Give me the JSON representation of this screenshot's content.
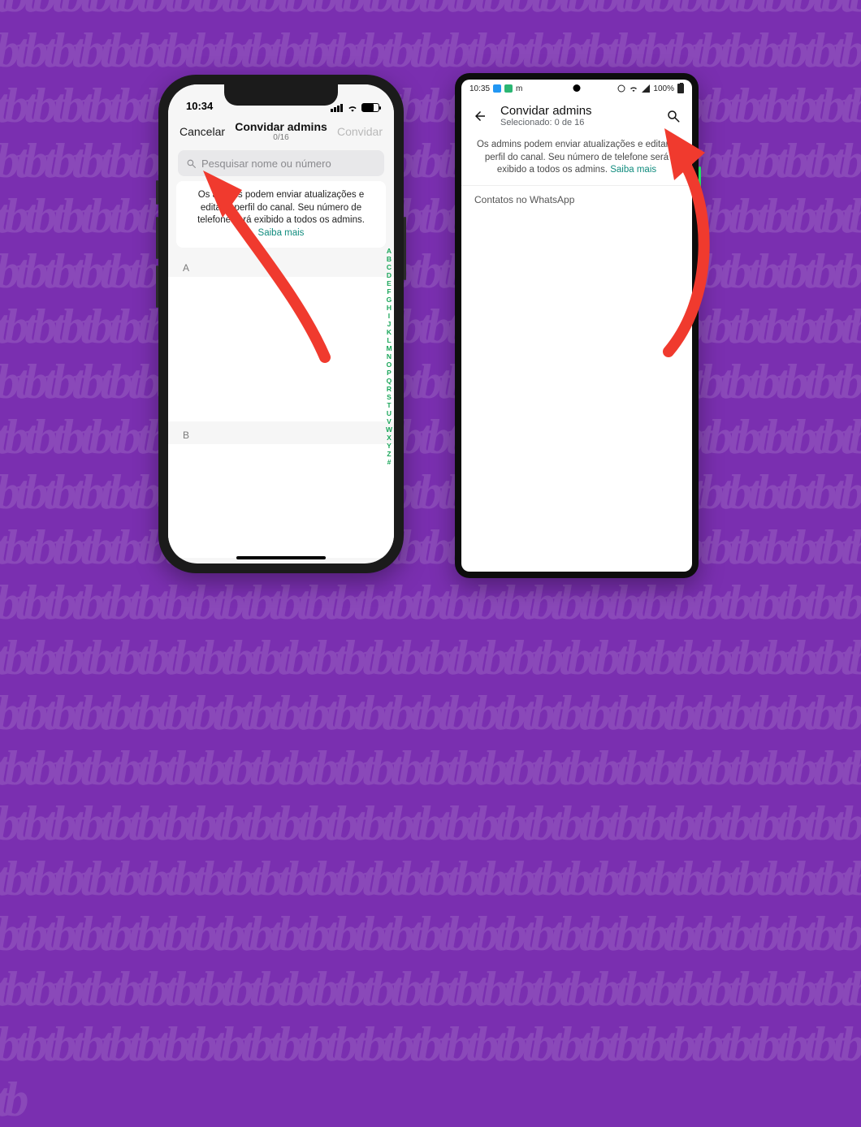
{
  "bg_text": "tbtbtbtbtbtbtbtbtbtbtbtbtbtbtbtbtbtbtbtbtbtbtbtbtbtbtbtbtbtbtbtbtbtbtbtbtbtbtbtbtbtbtbtbtbtbtbtbtbtbtbtbtbtbtbtbtbtbtbtbtbtbtbtbtbtbtbtbtbtbtbtbtbtbtbtbtbtbtbtbtbtbtbtbtbtbtbtbtbtbtbtbtbtbtbtbtbtbtbtbtbtbtbtbtbtbtbtbtbtbtbtbtbtbtbtbtbtbtbtbtbtbtbtbtbtbtbtbtbtbtbtbtbtbtbtbtbtbtbtbtbtbtbtbtbtbtbtbtbtbtbtbtbtbtbtbtbtbtbtbtbtbtbtbtbtbtbtbtbtbtbtbtbtbtbtbtbtbtbtbtbtbtbtbtbtbtbtbtbtbtbtbtbtbtbtbtbtbtbtbtbtbtbtbtbtbtbtbtbtbtbtbtbtbtbtbtbtbtbtbtbtbtbtbtbtbtbtbtbtbtbtbtbtbtbtbtbtbtbtbtbtbtbtbtbtbtbtbtbtbtbtbtbtbtbtbtbtbtbtbtbtbtbtbtbtbtbtbtbtbtbtbtbtbtbtbtbtbtbtbtbtbtbtbtbtbtbtbtbtbtbtbtbtbtbtbtbtbtbtbtbtbtbtbtbtbtbtbtbtbtbtbtbtbtbtbtbtbtbtbtbtbtbtbtbtbtbtbtbtbtbtbtbtbtbtbtbtbtbtbtbtbtbtbtbtbtbtbtbtbtbtbtbtbtbtbtbtbtbtbtbtbtbtbtbtbtbtbtbtbtbtbtbtbtbtbtbtbtbtbtbtbtbtbtbtbtbtbtbtbtbtbtbtbtbtbtbtbtbtbtbtbtbtbtbtbtbtbtbtbtbtbtbtbtbtbtbtbtbtbtbtbtbtbtbtbtbtbtbtbtbtbtbtbtbtbtbtbtbtbtbtbtbtbtbtbtbtbtbtbtbtbtbtbtbtbtbtbtbtbtbtbtbtbtbtbtbtbtbtbtbtbtbtbtbtbtbtbtbtbtbtbtbtbtbtbtbtbtbtbtbtbtbtbtbtbtbtbtbtbtbtbtbtbtbtbtbtbtbtbtbtbtbtbtbtbtbtbtbtbtbtbtbtbtbtbtbtbtbtbtbtbtbtbtbtbtbtbtbtbtbtbtbtbtbtbtbtbtbtbtbtbtbtbtbtbtbtbtbtbtbtbtbtbtbtbtbtbtbtbtbtbtbtbtbtbtbtbtbtbtbtbtbtbtbtbtbtbtbtbtbtbtbtbtbtbtbtbtbtbtbtbtbtbtbtbtbtbtbtbtbtbtbtbtbtbtbtbtbtbtbtbtbtbtbtbtbtbtbtbtbtbtbtbtbtbtbtbtbtbtbtbtbtbtbtbtbtbtbtbtbtb",
  "ios": {
    "status_time": "10:34",
    "nav": {
      "cancel": "Cancelar",
      "title": "Convidar admins",
      "sub": "0/16",
      "invite": "Convidar"
    },
    "search_placeholder": "Pesquisar nome ou número",
    "info_text": "Os admins podem enviar atualizações e editar o perfil do canal. Seu número de telefone será exibido a todos os admins.",
    "learn_more": "Saiba mais",
    "sections": {
      "a": "A",
      "b": "B"
    },
    "az": [
      "A",
      "B",
      "C",
      "D",
      "E",
      "F",
      "G",
      "H",
      "I",
      "J",
      "K",
      "L",
      "M",
      "N",
      "O",
      "P",
      "Q",
      "R",
      "S",
      "T",
      "U",
      "V",
      "W",
      "X",
      "Y",
      "Z",
      "#"
    ]
  },
  "android": {
    "status_time": "10:35",
    "status_m": "m",
    "status_batt": "100%",
    "nav": {
      "title": "Convidar admins",
      "sub": "Selecionado: 0 de 16"
    },
    "info_text": "Os admins podem enviar atualizações e editar o perfil do canal. Seu número de telefone será exibido a todos os admins.",
    "learn_more": "Saiba mais",
    "section_label": "Contatos no WhatsApp"
  }
}
